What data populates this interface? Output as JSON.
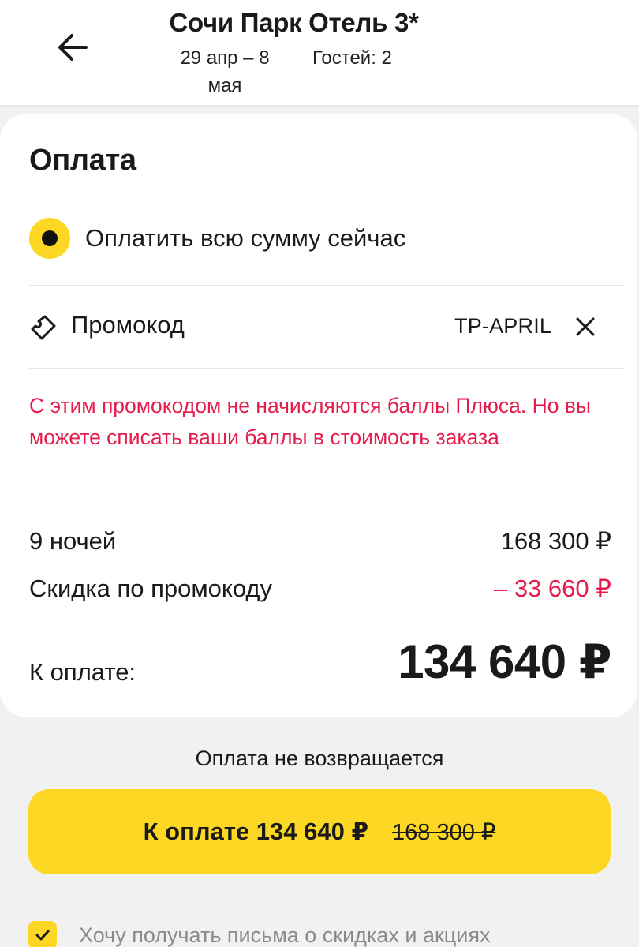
{
  "header": {
    "back_icon": "arrow-left-icon",
    "title": "Сочи Парк Отель 3*",
    "dates": "29 апр – 8 мая",
    "guests": "Гостей: 2"
  },
  "payment": {
    "title": "Оплата",
    "option_label": "Оплатить всю сумму сейчас",
    "option_selected": true,
    "promo": {
      "icon": "tag-icon",
      "label": "Промокод",
      "code": "TP-APRIL",
      "clear_icon": "close-icon"
    },
    "warning": "С этим промокодом не начисляются баллы Плюса. Но вы можете списать ваши баллы в стоимость заказа",
    "nights": {
      "label": "9 ночей",
      "value": "168 300 ₽"
    },
    "discount": {
      "label": "Скидка по промокоду",
      "value": "– 33 660 ₽"
    },
    "total": {
      "label": "К оплате:",
      "value": "134 640 ₽"
    }
  },
  "footer": {
    "refund_note": "Оплата не возвращается",
    "pay_button_label": "К оплате 134 640 ₽",
    "pay_button_old_price": "168 300 ₽",
    "newsletter_label": "Хочу получать письма о скидках и акциях",
    "newsletter_checked": true
  },
  "colors": {
    "accent": "#fcd824",
    "error": "#e61c4d",
    "background": "#f1f1f1",
    "card": "#ffffff"
  }
}
